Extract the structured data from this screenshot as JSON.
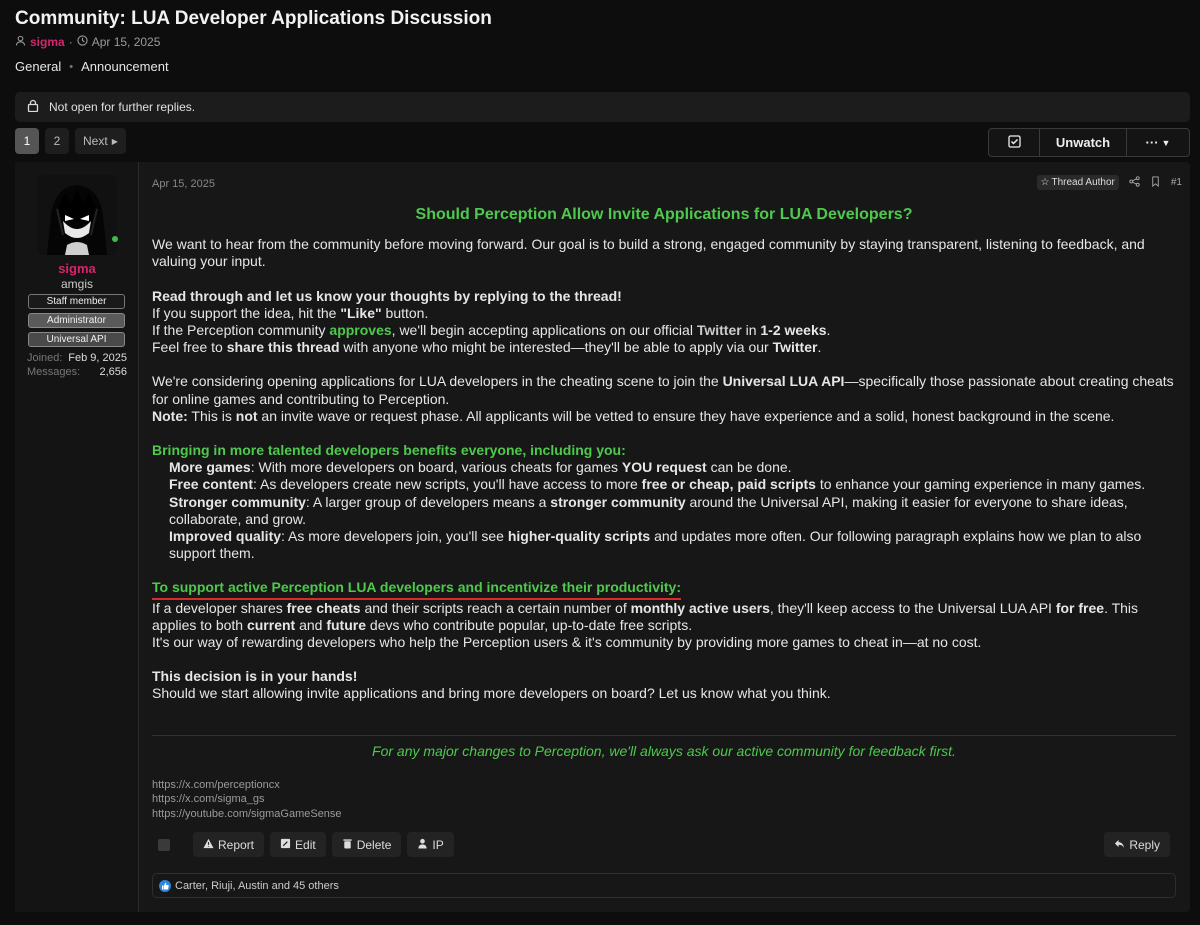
{
  "thread": {
    "title": "Community: LUA Developer Applications Discussion",
    "author": "sigma",
    "date": "Apr 15, 2025",
    "tags": [
      "General",
      "Announcement"
    ]
  },
  "notice": "Not open for further replies.",
  "pagination": {
    "pages": [
      "1",
      "2"
    ],
    "current": "1",
    "next_label": "Next"
  },
  "thread_actions": {
    "unwatch_label": "Unwatch"
  },
  "user": {
    "name": "sigma",
    "title": "amgis",
    "badges": [
      "Staff member",
      "Administrator",
      "Universal API"
    ],
    "joined_label": "Joined:",
    "joined": "Feb 9, 2025",
    "messages_label": "Messages:",
    "messages": "2,656"
  },
  "post": {
    "date": "Apr 15, 2025",
    "thread_author_label": "Thread Author",
    "number": "#1",
    "heading": "Should Perception Allow Invite Applications for LUA Developers?",
    "intro": "We want to hear from the community before moving forward. Our goal is to build a strong, engaged community by staying transparent, listening to feedback, and valuing your input.",
    "p2_bold": "Read through and let us know your thoughts by replying to the thread!",
    "p2_l1a": "If you support the idea, hit the ",
    "p2_l1b": "\"Like\"",
    "p2_l1c": " button.",
    "p2_l2a": "If the Perception community ",
    "p2_l2b": "approves",
    "p2_l2c": ", we'll begin accepting applications on our official ",
    "p2_l2d": "Twitter",
    "p2_l2e": " in ",
    "p2_l2f": "1-2 weeks",
    "p2_l2g": ".",
    "p2_l3a": "Feel free to ",
    "p2_l3b": "share this thread",
    "p2_l3c": " with anyone who might be interested—they'll be able to apply via our ",
    "p2_l3d": "Twitter",
    "p2_l3e": ".",
    "p3a": "We're considering opening applications for LUA developers in the cheating scene to join the ",
    "p3b": "Universal LUA API",
    "p3c": "—specifically those passionate about creating cheats for online games and contributing to Perception.",
    "note_label": "Note:",
    "note_a": " This is ",
    "note_b": "not",
    "note_c": " an invite wave or request phase. All applicants will be vetted to ensure they have experience and a solid, honest background in the scene.",
    "benefits_heading": "Bringing in more talented developers benefits everyone, including you:",
    "b1_label": "More games",
    "b1_a": ": With more developers on board, various cheats for games ",
    "b1_b": "YOU request",
    "b1_c": " can be done.",
    "b2_label": "Free content",
    "b2_a": ": As developers create new scripts, you'll have access to more ",
    "b2_b": "free or cheap, paid scripts",
    "b2_c": " to enhance your gaming experience in many games.",
    "b3_label": "Stronger community",
    "b3_a": ": A larger group of developers means a ",
    "b3_b": "stronger community",
    "b3_c": " around the Universal API, making it easier for everyone to share ideas, collaborate, and grow.",
    "b4_label": "Improved quality",
    "b4_a": ": As more developers join, you'll see ",
    "b4_b": "higher-quality scripts",
    "b4_c": " and updates more often. Our following paragraph explains how we plan to also support them.",
    "support_heading": "To support active Perception LUA developers and incentivize their productivity:",
    "s1_a": "If a developer shares ",
    "s1_b": "free cheats",
    "s1_c": " and their scripts reach a certain number of ",
    "s1_d": "monthly active users",
    "s1_e": ", they'll keep access to the Universal LUA API ",
    "s1_f": "for free",
    "s1_g": ". This applies to both ",
    "s1_h": "current",
    "s1_i": " and ",
    "s1_j": "future",
    "s1_k": " devs who contribute popular, up-to-date free scripts.",
    "s2": "It's our way of rewarding developers who help the Perception users & it's community by providing more games to cheat in—at no cost.",
    "decision_bold": "This decision is in your hands!",
    "decision_text": "Should we start allowing invite applications and bring more developers on board? Let us know what you think.",
    "footer_note": "For any major changes to Perception, we'll always ask our active community for feedback first.",
    "links": [
      "https://x.com/perceptioncx",
      "https://x.com/sigma_gs",
      "https://youtube.com/sigmaGameSense"
    ]
  },
  "post_actions": {
    "report": "Report",
    "edit": "Edit",
    "delete": "Delete",
    "ip": "IP",
    "reply": "Reply"
  },
  "reactions": {
    "text": "Carter, Riuji, Austin and 45 others"
  },
  "colors": {
    "accent_green": "#4ec94e",
    "username_pink": "#d6246e",
    "underline_red": "#d92b2b"
  }
}
